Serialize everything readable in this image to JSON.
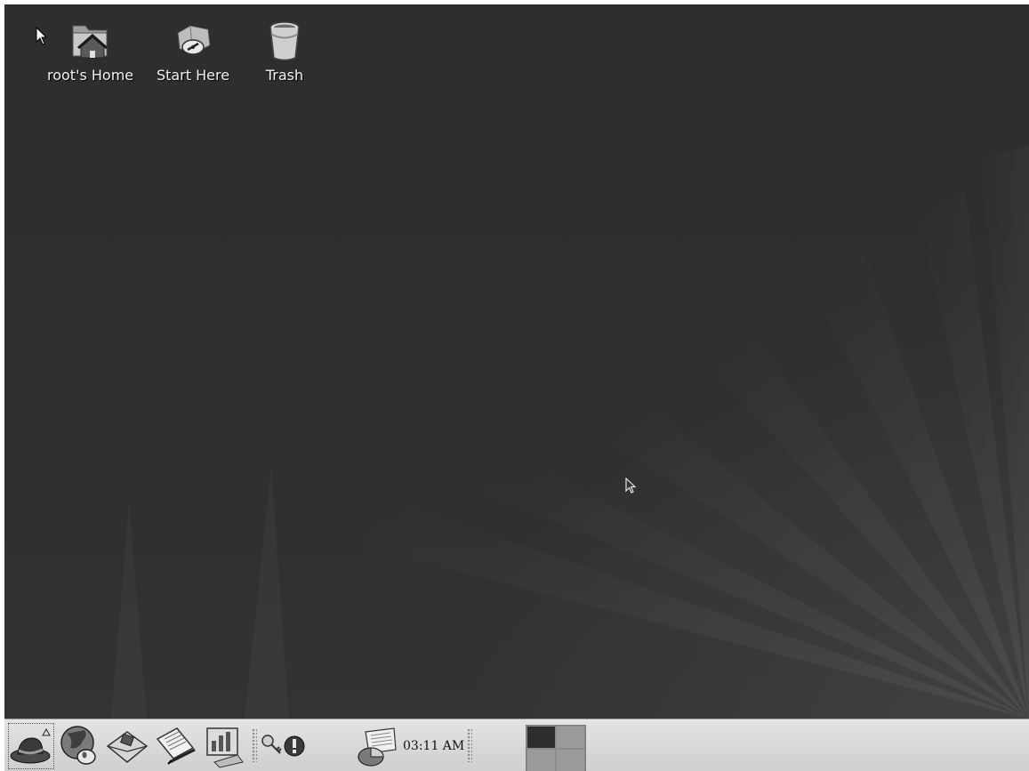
{
  "desktop": {
    "icons": [
      {
        "label": "root's Home",
        "icon": "home-folder-icon"
      },
      {
        "label": "Start Here",
        "icon": "start-here-icon"
      },
      {
        "label": "Trash",
        "icon": "trash-icon"
      }
    ]
  },
  "panel": {
    "launchers": [
      {
        "name": "main-menu-hat",
        "icon": "redhat-hat-icon"
      },
      {
        "name": "web-browser",
        "icon": "globe-mouse-icon"
      },
      {
        "name": "email-client",
        "icon": "envelope-stamp-icon"
      },
      {
        "name": "word-processor",
        "icon": "document-pen-icon"
      },
      {
        "name": "presentation",
        "icon": "presentation-chart-icon"
      },
      {
        "name": "network-status",
        "icon": "network-keys-icon"
      },
      {
        "name": "alert",
        "icon": "alert-exclamation-icon"
      },
      {
        "name": "notes",
        "icon": "notes-icon"
      }
    ],
    "clock": "03:11 AM",
    "pager": {
      "workspaces": 4,
      "active": 1
    }
  },
  "colors": {
    "desktop_background": "#2f2f2f",
    "panel_background": "#d8d8d8",
    "active_workspace": "#2e2e2e",
    "inactive_workspace": "#9a9a9a"
  }
}
